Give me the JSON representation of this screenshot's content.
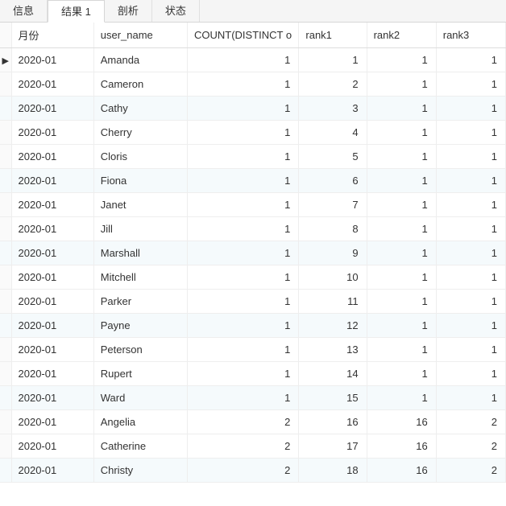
{
  "tabs": [
    {
      "label": "信息",
      "active": false
    },
    {
      "label": "结果 1",
      "active": true
    },
    {
      "label": "剖析",
      "active": false
    },
    {
      "label": "状态",
      "active": false
    }
  ],
  "columns": [
    "月份",
    "user_name",
    "COUNT(DISTINCT o",
    "rank1",
    "rank2",
    "rank3"
  ],
  "rows": [
    {
      "month": "2020-01",
      "user_name": "Amanda",
      "count": 1,
      "rank1": 1,
      "rank2": 1,
      "rank3": 1,
      "current": true,
      "alt": false
    },
    {
      "month": "2020-01",
      "user_name": "Cameron",
      "count": 1,
      "rank1": 2,
      "rank2": 1,
      "rank3": 1,
      "current": false,
      "alt": false
    },
    {
      "month": "2020-01",
      "user_name": "Cathy",
      "count": 1,
      "rank1": 3,
      "rank2": 1,
      "rank3": 1,
      "current": false,
      "alt": true
    },
    {
      "month": "2020-01",
      "user_name": "Cherry",
      "count": 1,
      "rank1": 4,
      "rank2": 1,
      "rank3": 1,
      "current": false,
      "alt": false
    },
    {
      "month": "2020-01",
      "user_name": "Cloris",
      "count": 1,
      "rank1": 5,
      "rank2": 1,
      "rank3": 1,
      "current": false,
      "alt": false
    },
    {
      "month": "2020-01",
      "user_name": "Fiona",
      "count": 1,
      "rank1": 6,
      "rank2": 1,
      "rank3": 1,
      "current": false,
      "alt": true
    },
    {
      "month": "2020-01",
      "user_name": "Janet",
      "count": 1,
      "rank1": 7,
      "rank2": 1,
      "rank3": 1,
      "current": false,
      "alt": false
    },
    {
      "month": "2020-01",
      "user_name": "Jill",
      "count": 1,
      "rank1": 8,
      "rank2": 1,
      "rank3": 1,
      "current": false,
      "alt": false
    },
    {
      "month": "2020-01",
      "user_name": "Marshall",
      "count": 1,
      "rank1": 9,
      "rank2": 1,
      "rank3": 1,
      "current": false,
      "alt": true
    },
    {
      "month": "2020-01",
      "user_name": "Mitchell",
      "count": 1,
      "rank1": 10,
      "rank2": 1,
      "rank3": 1,
      "current": false,
      "alt": false
    },
    {
      "month": "2020-01",
      "user_name": "Parker",
      "count": 1,
      "rank1": 11,
      "rank2": 1,
      "rank3": 1,
      "current": false,
      "alt": false
    },
    {
      "month": "2020-01",
      "user_name": "Payne",
      "count": 1,
      "rank1": 12,
      "rank2": 1,
      "rank3": 1,
      "current": false,
      "alt": true
    },
    {
      "month": "2020-01",
      "user_name": "Peterson",
      "count": 1,
      "rank1": 13,
      "rank2": 1,
      "rank3": 1,
      "current": false,
      "alt": false
    },
    {
      "month": "2020-01",
      "user_name": "Rupert",
      "count": 1,
      "rank1": 14,
      "rank2": 1,
      "rank3": 1,
      "current": false,
      "alt": false
    },
    {
      "month": "2020-01",
      "user_name": "Ward",
      "count": 1,
      "rank1": 15,
      "rank2": 1,
      "rank3": 1,
      "current": false,
      "alt": true
    },
    {
      "month": "2020-01",
      "user_name": "Angelia",
      "count": 2,
      "rank1": 16,
      "rank2": 16,
      "rank3": 2,
      "current": false,
      "alt": false
    },
    {
      "month": "2020-01",
      "user_name": "Catherine",
      "count": 2,
      "rank1": 17,
      "rank2": 16,
      "rank3": 2,
      "current": false,
      "alt": false
    },
    {
      "month": "2020-01",
      "user_name": "Christy",
      "count": 2,
      "rank1": 18,
      "rank2": 16,
      "rank3": 2,
      "current": false,
      "alt": true
    }
  ]
}
